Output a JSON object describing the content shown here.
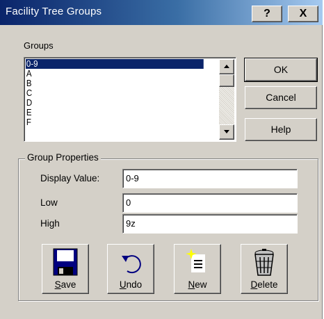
{
  "window": {
    "title": "Facility Tree Groups",
    "help_button": "?",
    "close_button": "X"
  },
  "groups": {
    "label": "Groups",
    "items": [
      "0-9",
      "A",
      "B",
      "C",
      "D",
      "E",
      "F"
    ],
    "selected_index": 0
  },
  "buttons": {
    "ok": "OK",
    "cancel": "Cancel",
    "help": "Help"
  },
  "properties": {
    "legend": "Group Properties",
    "display_value_label": "Display Value:",
    "display_value": "0-9",
    "low_label": "Low",
    "low_value": "0",
    "high_label": "High",
    "high_value": "9z"
  },
  "actions": {
    "save": {
      "mnemonic": "S",
      "rest": "ave",
      "icon": "floppy-disk-icon"
    },
    "undo": {
      "mnemonic": "U",
      "rest": "ndo",
      "icon": "undo-arrow-icon"
    },
    "new": {
      "mnemonic": "N",
      "rest": "ew",
      "icon": "new-document-icon"
    },
    "delete": {
      "mnemonic": "D",
      "rest": "elete",
      "icon": "trash-can-icon"
    }
  },
  "colors": {
    "title_bar": "#0a246a",
    "selection": "#0a246a",
    "dialog_face": "#d4d0c8"
  }
}
